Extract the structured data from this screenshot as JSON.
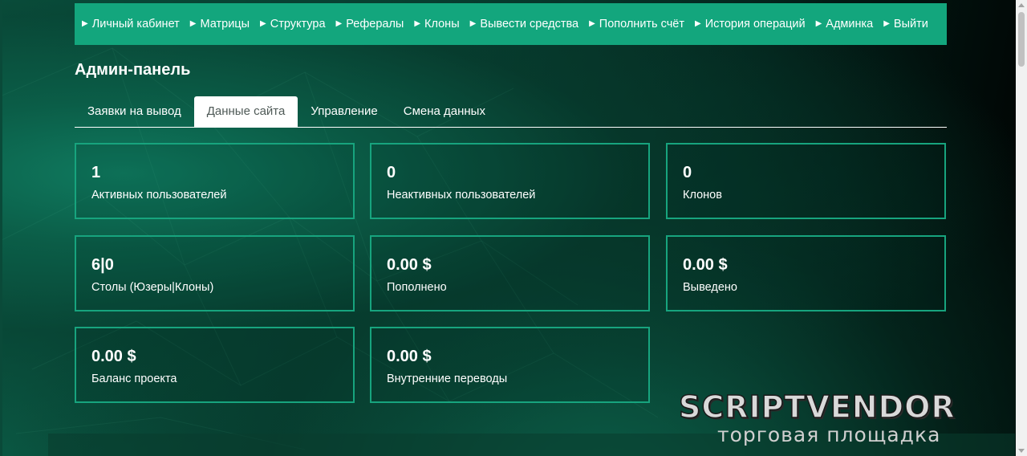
{
  "nav": {
    "items": [
      {
        "label": "Личный кабинет"
      },
      {
        "label": "Матрицы"
      },
      {
        "label": "Структура"
      },
      {
        "label": "Рефералы"
      },
      {
        "label": "Клоны"
      },
      {
        "label": "Вывести средства"
      },
      {
        "label": "Пополнить счёт"
      },
      {
        "label": "История операций"
      },
      {
        "label": "Админка"
      },
      {
        "label": "Выйти"
      }
    ],
    "arrow_icon": "▶"
  },
  "page": {
    "title": "Админ-панель"
  },
  "tabs": [
    {
      "label": "Заявки на вывод"
    },
    {
      "label": "Данные сайта"
    },
    {
      "label": "Управление"
    },
    {
      "label": "Смена данных"
    }
  ],
  "active_tab": "Данные сайта",
  "stats": [
    {
      "value": "1",
      "label": "Активных пользователей"
    },
    {
      "value": "0",
      "label": "Неактивных пользователей"
    },
    {
      "value": "0",
      "label": "Клонов"
    },
    {
      "value": "6|0",
      "label": "Столы (Юзеры|Клоны)"
    },
    {
      "value": "0.00 $",
      "label": "Пополнено"
    },
    {
      "value": "0.00 $",
      "label": "Выведено"
    },
    {
      "value": "0.00 $",
      "label": "Баланс проекта"
    },
    {
      "value": "0.00 $",
      "label": "Внутренние переводы"
    }
  ],
  "watermark": {
    "logo": "SCRIPTVENDOR",
    "subtitle": "торговая площадка"
  },
  "colors": {
    "accent": "#13a67d",
    "card_border": "#17a47e",
    "text": "#ffffff",
    "active_tab_text": "#4f5a57"
  }
}
